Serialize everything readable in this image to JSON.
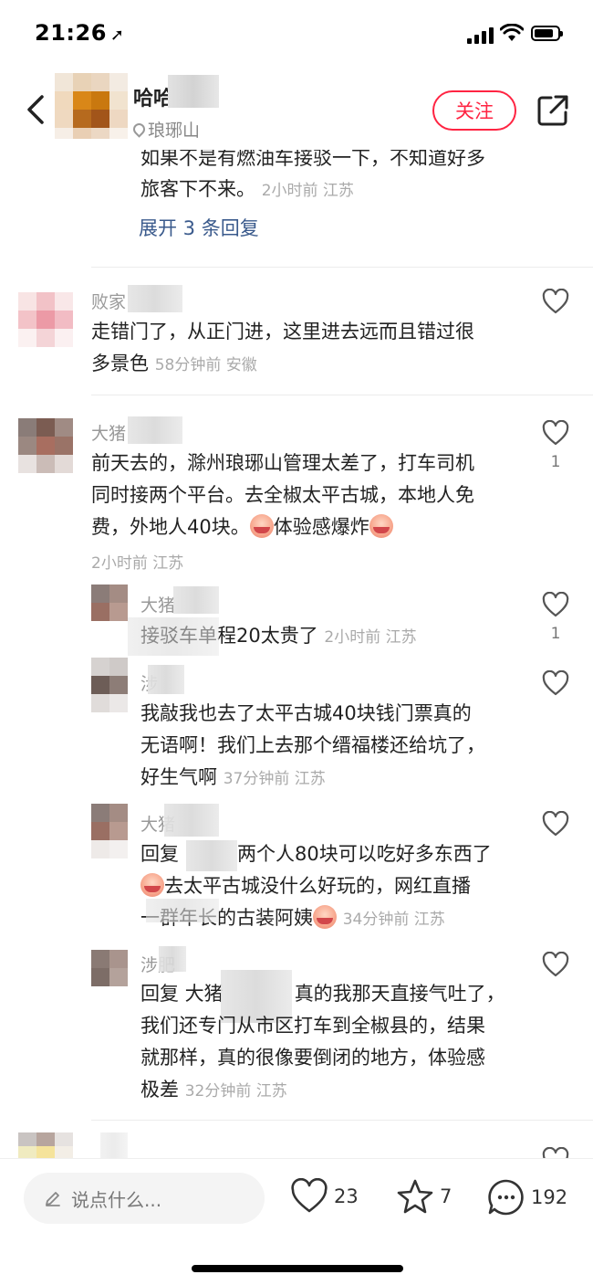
{
  "status": {
    "time": "21:26"
  },
  "header": {
    "author_name": "哈哈",
    "location": "琅琊山",
    "follow_label": "关注"
  },
  "thread_tail": {
    "line1": "如果不是有燃油车接驳一下，不知道好多",
    "line2": "旅客下不来。",
    "meta": "2小时前 江苏",
    "expand": "展开 3 条回复"
  },
  "comments": [
    {
      "user": "败家",
      "lines": [
        "走错门了，从正门进，这里进去远而且错过很",
        "多景色"
      ],
      "meta": "58分钟前 安徽"
    },
    {
      "user": "大猪",
      "lines": [
        "前天去的，滁州琅琊山管理太差了，打车司机",
        "同时接两个平台。去全椒太平古城，本地人免",
        "费，外地人40块。",
        "体验感爆炸"
      ],
      "meta": "2小时前 江苏",
      "likes": "1"
    }
  ],
  "replies": [
    {
      "user": "大猪",
      "text": "接驳车单程20太贵了",
      "meta": "2小时前 江苏",
      "likes": "1"
    },
    {
      "user": "涉",
      "lines": [
        "我敲我也去了太平古城40块钱门票真的",
        "无语啊！我们上去那个缙福楼还给坑了，",
        "好生气啊"
      ],
      "meta": "37分钟前 江苏"
    },
    {
      "user": "大猪",
      "lines": [
        "回复",
        "两个人80块可以吃好多东西了",
        "去太平古城没什么好玩的，网红直播",
        "一群年长的古装阿姨"
      ],
      "meta": "34分钟前 江苏"
    },
    {
      "user": "涉肥",
      "lines": [
        "回复 大猪",
        "真的我那天直接气吐了，",
        "我们还专门从市区打车到全椒县的，结果",
        "就那样，真的很像要倒闭的地方，体验感",
        "极差"
      ],
      "meta": "32分钟前 江苏"
    }
  ],
  "bottom_bar": {
    "placeholder": "说点什么...",
    "likes": "23",
    "stars": "7",
    "comments": "192"
  },
  "colors": {
    "accent": "#ff2442",
    "link": "#3a5a8c"
  }
}
